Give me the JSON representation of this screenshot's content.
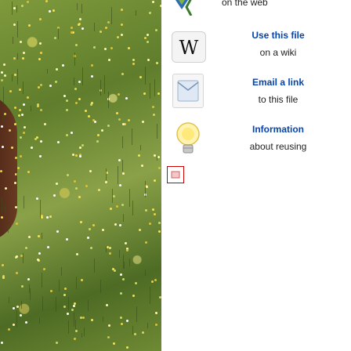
{
  "tools": {
    "web": {
      "subtitle": "on the web"
    },
    "wiki": {
      "title": "Use this file",
      "subtitle": "on a wiki",
      "icon": "wikipedia-w-icon"
    },
    "email": {
      "title": "Email a link",
      "subtitle": "to this file",
      "icon": "envelope-icon"
    },
    "info": {
      "title": "Information",
      "subtitle": "about reusing",
      "icon": "lightbulb-icon"
    }
  },
  "colors": {
    "link": "#0645ad",
    "text": "#222222",
    "broken_image_border": "#cc0000"
  }
}
